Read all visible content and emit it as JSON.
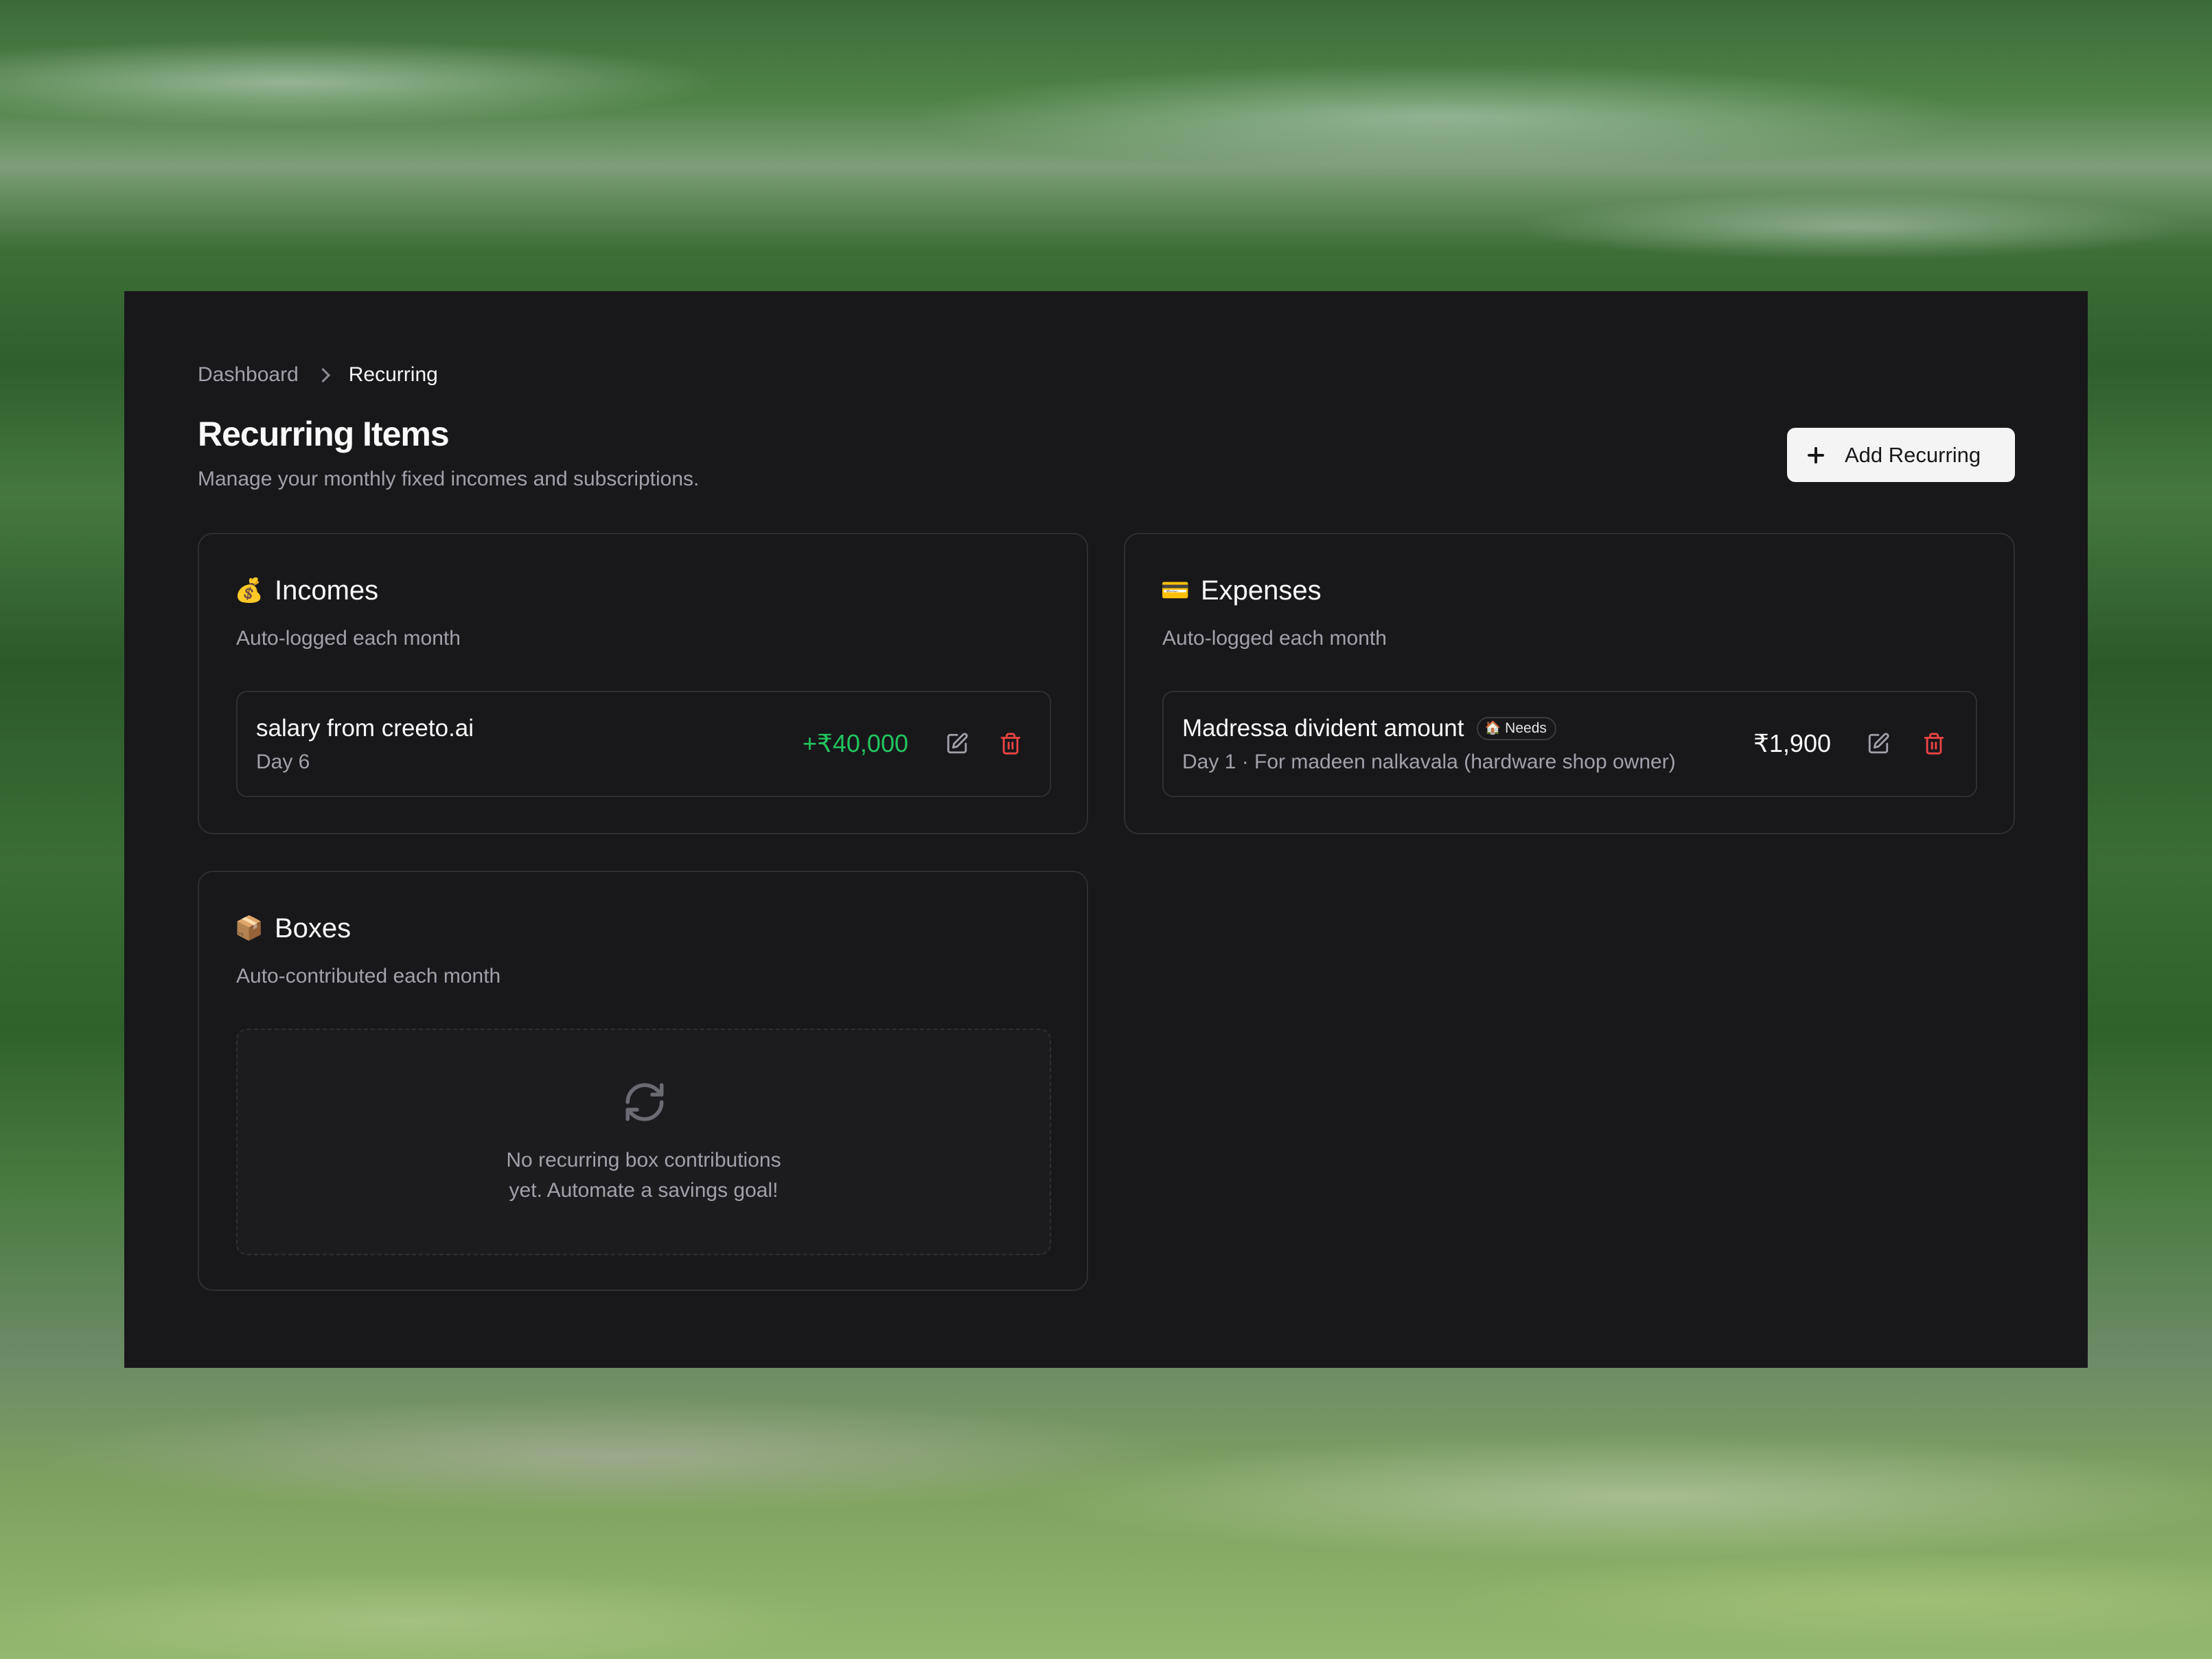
{
  "breadcrumb": {
    "root": "Dashboard",
    "current": "Recurring"
  },
  "header": {
    "title": "Recurring Items",
    "subtitle": "Manage your monthly fixed incomes and subscriptions.",
    "add_button_label": "Add Recurring"
  },
  "incomes": {
    "emoji": "💰",
    "title": "Incomes",
    "subtitle": "Auto-logged each month",
    "items": [
      {
        "name": "salary from creeto.ai",
        "meta": "Day 6",
        "amount": "+₹40,000"
      }
    ]
  },
  "expenses": {
    "emoji": "💳",
    "title": "Expenses",
    "subtitle": "Auto-logged each month",
    "items": [
      {
        "name": "Madressa divident amount",
        "badge_emoji": "🏠",
        "badge": "Needs",
        "meta": "Day 1 · For madeen nalkavala (hardware shop owner)",
        "amount": "₹1,900"
      }
    ]
  },
  "boxes": {
    "emoji": "📦",
    "title": "Boxes",
    "subtitle": "Auto-contributed each month",
    "empty_line1": "No recurring box contributions",
    "empty_line2": "yet. Automate a savings goal!"
  },
  "colors": {
    "panel_bg": "#18181b",
    "income_amount": "#22c55e",
    "delete_icon": "#ef4444",
    "border": "#2e2e33"
  },
  "icons": {
    "edit": "edit-icon",
    "delete": "trash-icon",
    "add": "plus-icon",
    "empty": "refresh-icon",
    "breadcrumb_separator": "chevron-right-icon"
  }
}
